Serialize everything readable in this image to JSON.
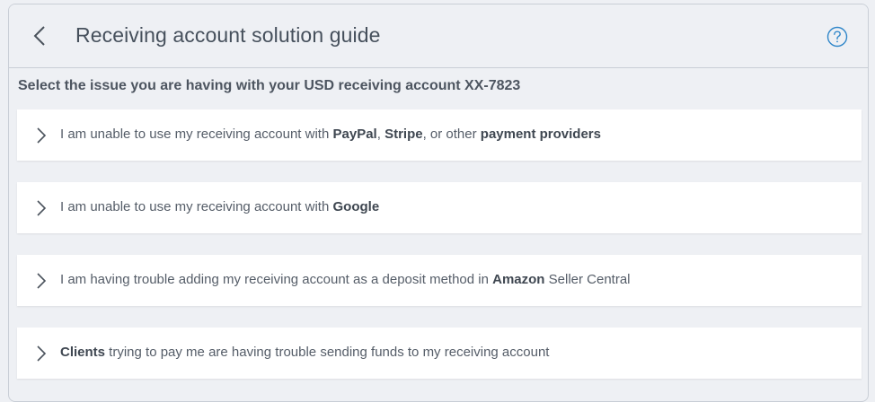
{
  "header": {
    "title": "Receiving account solution guide"
  },
  "subtitle": "Select the issue you are having with your USD receiving account XX-7823",
  "issues": [
    {
      "parts": [
        {
          "text": "I am unable to use my receiving account with ",
          "bold": false
        },
        {
          "text": "PayPal",
          "bold": true
        },
        {
          "text": ", ",
          "bold": false
        },
        {
          "text": "Stripe",
          "bold": true
        },
        {
          "text": ", or other ",
          "bold": false
        },
        {
          "text": "payment providers",
          "bold": true
        }
      ]
    },
    {
      "parts": [
        {
          "text": "I am unable to use my receiving account with ",
          "bold": false
        },
        {
          "text": "Google",
          "bold": true
        }
      ]
    },
    {
      "parts": [
        {
          "text": "I am having trouble adding my receiving account as a deposit method in ",
          "bold": false
        },
        {
          "text": "Amazon",
          "bold": true
        },
        {
          "text": " Seller Central",
          "bold": false
        }
      ]
    },
    {
      "parts": [
        {
          "text": "Clients",
          "bold": true
        },
        {
          "text": " trying to pay me are having trouble sending funds to my receiving account",
          "bold": false
        }
      ]
    }
  ],
  "icons": {
    "back": "chevron-left-icon",
    "help": "question-circle-icon",
    "expand": "chevron-right-icon"
  },
  "colors": {
    "accent": "#2f86c9",
    "text": "#46505c",
    "background": "#eef0f4",
    "card": "#ffffff"
  }
}
